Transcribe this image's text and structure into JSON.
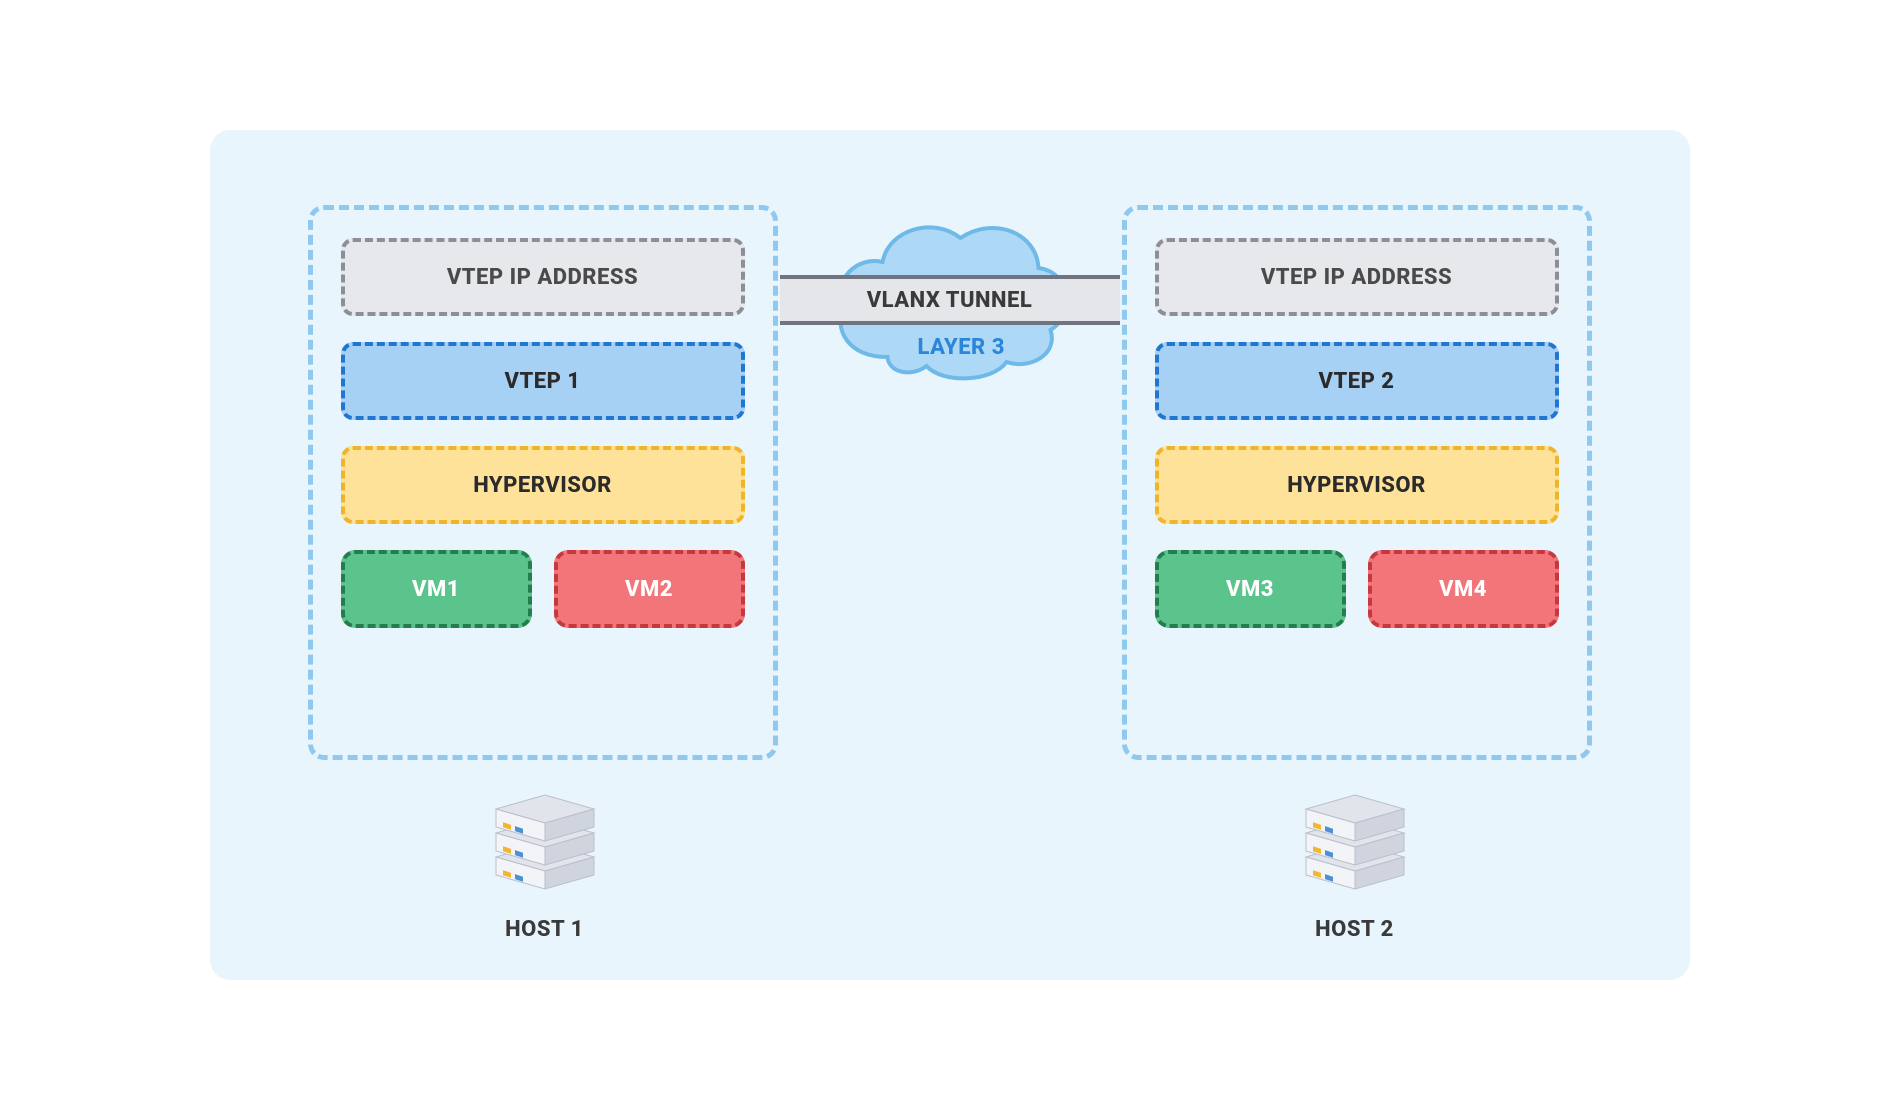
{
  "tunnel": {
    "label": "VLANX TUNNEL",
    "layer_label": "LAYER 3"
  },
  "host1": {
    "label": "HOST 1",
    "vtep_ip": "VTEP IP ADDRESS",
    "vtep": "VTEP 1",
    "hypervisor": "HYPERVISOR",
    "vm_a": "VM1",
    "vm_b": "VM2"
  },
  "host2": {
    "label": "HOST 2",
    "vtep_ip": "VTEP IP ADDRESS",
    "vtep": "VTEP 2",
    "hypervisor": "HYPERVISOR",
    "vm_a": "VM3",
    "vm_b": "VM4"
  },
  "colors": {
    "frameBg": "#e9f5fd",
    "hostBorder": "#8fc9f0",
    "gray": {
      "fill": "#e7e8ec",
      "border": "#8c8f9a"
    },
    "blue": {
      "fill": "#a6d1f4",
      "border": "#2176d2"
    },
    "yellow": {
      "fill": "#ffe29a",
      "border": "#f0b429"
    },
    "green": {
      "fill": "#5bc48d",
      "border": "#257c4f"
    },
    "red": {
      "fill": "#f2757a",
      "border": "#c5383d"
    },
    "cloud": {
      "fill": "#aed9f6",
      "stroke": "#6fb9e8"
    }
  }
}
